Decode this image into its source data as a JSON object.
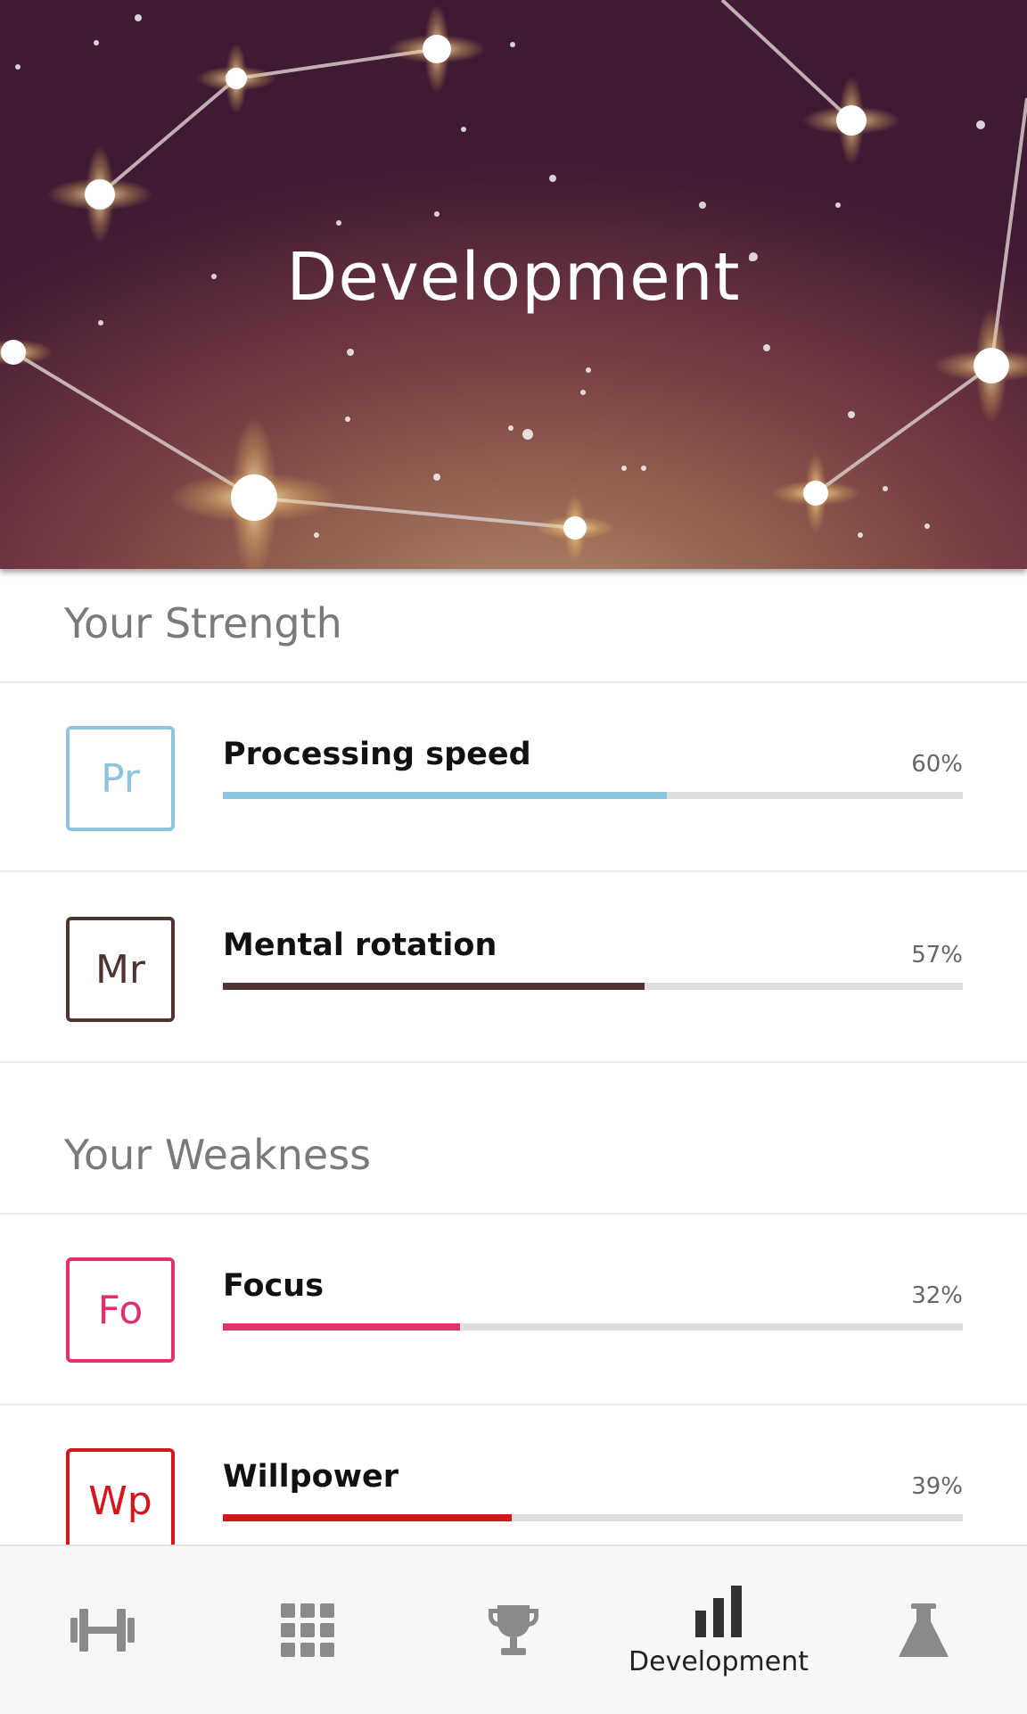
{
  "header": {
    "title": "Development"
  },
  "strength": {
    "title": "Your Strength",
    "items": [
      {
        "abbr": "Pr",
        "label": "Processing speed",
        "percent_text": "60%",
        "value": 0.6,
        "color": "#8ec4df"
      },
      {
        "abbr": "Mr",
        "label": "Mental rotation",
        "percent_text": "57%",
        "value": 0.57,
        "color": "#4e342e"
      }
    ]
  },
  "weakness": {
    "title": "Your Weakness",
    "items": [
      {
        "abbr": "Fo",
        "label": "Focus",
        "percent_text": "32%",
        "value": 0.32,
        "color": "#e0306d"
      },
      {
        "abbr": "Wp",
        "label": "Willpower",
        "percent_text": "39%",
        "value": 0.39,
        "color": "#d8141b"
      }
    ]
  },
  "nav": {
    "items": [
      {
        "icon": "dumbbell-icon",
        "label": ""
      },
      {
        "icon": "grid-icon",
        "label": ""
      },
      {
        "icon": "trophy-icon",
        "label": ""
      },
      {
        "icon": "bar-chart-icon",
        "label": "Development",
        "active": true
      },
      {
        "icon": "flask-icon",
        "label": ""
      }
    ],
    "active_color": "#333333",
    "inactive_color": "#8a8a8a"
  }
}
